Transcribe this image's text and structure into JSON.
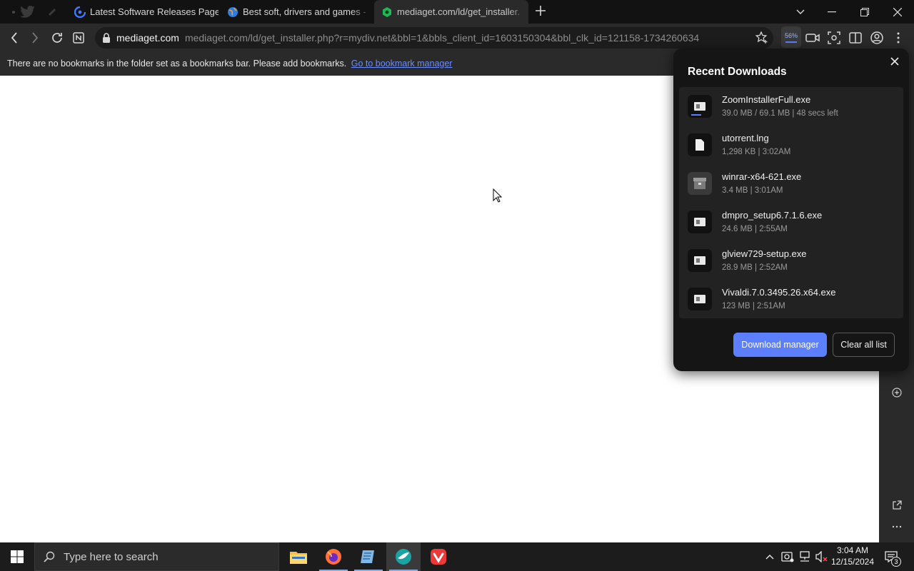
{
  "tabs": [
    {
      "title": "Latest Software Releases Page",
      "icon": "site-favicon",
      "active": false
    },
    {
      "title": "Best soft, drivers and games - ",
      "icon": "globe-favicon",
      "active": false
    },
    {
      "title": "mediaget.com/ld/get_installer.",
      "icon": "mediaget-favicon",
      "active": true
    }
  ],
  "address": {
    "host": "mediaget.com",
    "url": "mediaget.com/ld/get_installer.php?r=mydiv.net&bbl=1&bbls_client_id=1603150304&bbl_clk_id=121158-1734260634"
  },
  "toolbar": {
    "download_percent": "56%"
  },
  "bookmarks_bar": {
    "message": "There are no bookmarks in the folder set as a bookmarks bar. Please add bookmarks.",
    "link": "Go to bookmark manager"
  },
  "downloads": {
    "title": "Recent Downloads",
    "items": [
      {
        "name": "ZoomInstallerFull.exe",
        "meta": "39.0 MB / 69.1 MB | 48 secs left",
        "icon": "installer-icon",
        "progress": 0.56
      },
      {
        "name": "utorrent.lng",
        "meta": "1,298 KB | 3:02AM",
        "icon": "document-icon"
      },
      {
        "name": "winrar-x64-621.exe",
        "meta": "3.4 MB | 3:01AM",
        "icon": "archive-icon"
      },
      {
        "name": "dmpro_setup6.7.1.6.exe",
        "meta": "24.6 MB | 2:55AM",
        "icon": "installer-icon"
      },
      {
        "name": "glview729-setup.exe",
        "meta": "28.9 MB | 2:52AM",
        "icon": "installer-icon"
      },
      {
        "name": "Vivaldi.7.0.3495.26.x64.exe",
        "meta": "123 MB | 2:51AM",
        "icon": "installer-icon"
      }
    ],
    "primary_button": "Download manager",
    "secondary_button": "Clear all list"
  },
  "taskbar": {
    "search_placeholder": "Type here to search",
    "time": "3:04 AM",
    "date": "12/15/2024",
    "notification_count": "3"
  },
  "colors": {
    "accent": "#5b7fff",
    "panel_bg": "#151515",
    "chrome_bg": "#2a2a2a"
  }
}
